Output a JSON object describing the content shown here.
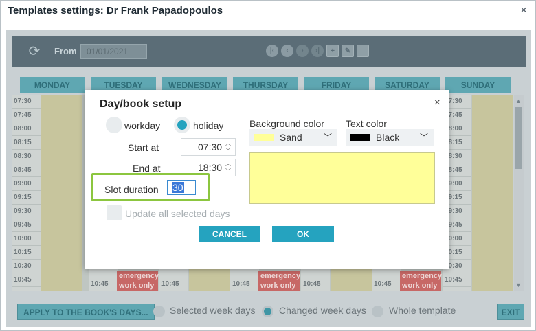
{
  "window": {
    "title": "Templates settings: Dr Frank Papadopoulos",
    "close_glyph": "×"
  },
  "toolbar": {
    "refresh_icon": "refresh-icon",
    "from_label": "From",
    "from_value": "01/01/2021",
    "nav_icons": [
      "first-icon",
      "prev-icon",
      "next-icon",
      "last-icon",
      "add-icon",
      "edit-icon",
      "remove-icon"
    ]
  },
  "days": [
    "MONDAY",
    "TUESDAY",
    "WEDNESDAY",
    "THURSDAY",
    "FRIDAY",
    "SATURDAY",
    "SUNDAY"
  ],
  "times": [
    "07:30",
    "07:45",
    "08:00",
    "08:15",
    "08:30",
    "08:45",
    "09:00",
    "09:15",
    "09:30",
    "09:45",
    "10:00",
    "10:15",
    "10:30",
    "10:45"
  ],
  "grid_extra": {
    "slot_time": "10:45",
    "emergency_line1": "emergency",
    "emergency_line2": "work only"
  },
  "bottom": {
    "apply_label": "APPLY TO THE BOOK'S DAYS...",
    "opt1": "Selected week days",
    "opt2": "Changed week days",
    "opt3": "Whole template",
    "selected": "Changed week days",
    "exit_label": "EXIT"
  },
  "dialog": {
    "title": "Day/book setup",
    "close_glyph": "×",
    "workday_label": "workday",
    "holiday_label": "holiday",
    "day_type_selected": "holiday",
    "start_label": "Start at",
    "start_value": "07:30",
    "end_label": "End at",
    "end_value": "18:30",
    "slot_label": "Slot duration",
    "slot_value": "30",
    "update_label": "Update all selected days",
    "bg_color_label": "Background color",
    "bg_color_name": "Sand",
    "bg_color_hex": "#ffff99",
    "text_color_label": "Text color",
    "text_color_name": "Black",
    "text_color_hex": "#000000",
    "cancel_label": "CANCEL",
    "ok_label": "OK"
  },
  "colors": {
    "accent": "#25a3bf",
    "highlight": "#8cc63f"
  }
}
